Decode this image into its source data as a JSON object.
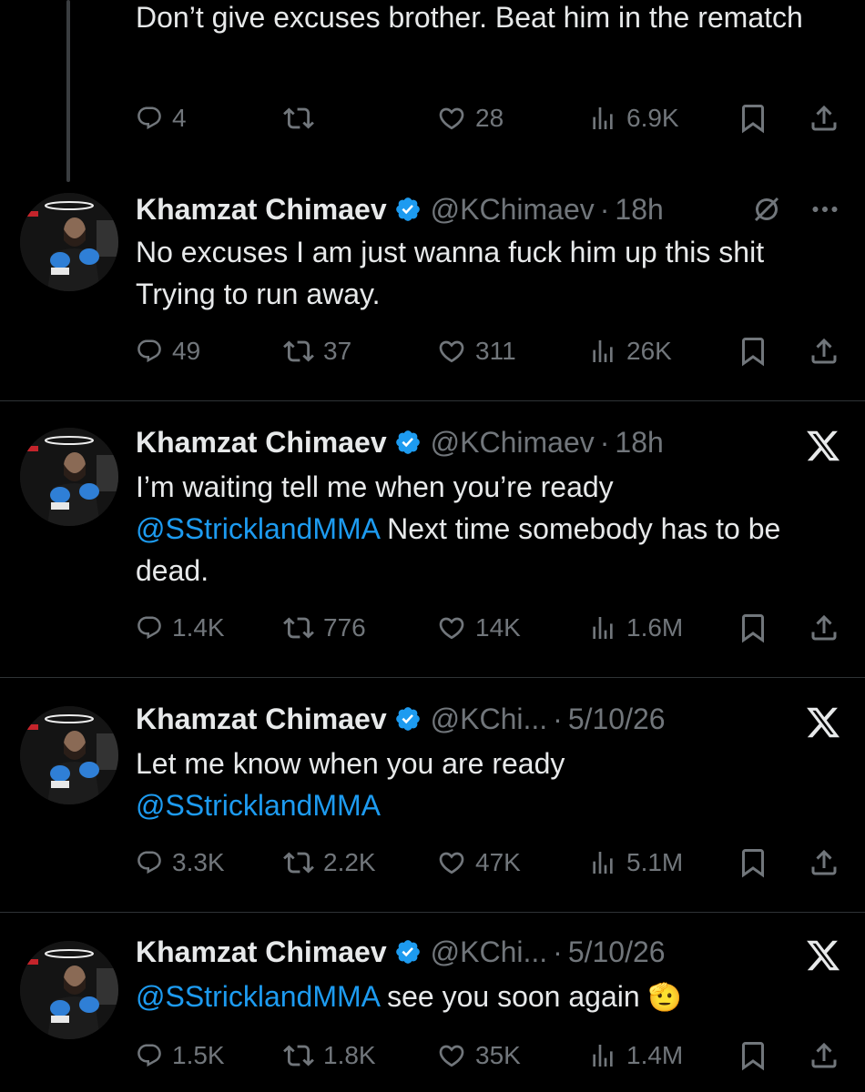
{
  "tweets": [
    {
      "text": "Don’t give excuses brother. Beat him in the rematch",
      "replies": "4",
      "reposts": "",
      "likes": "28",
      "views": "6.9K"
    },
    {
      "name": "Khamzat Chimaev",
      "handle": "@KChimaev",
      "time": "18h",
      "text": "No excuses I am just wanna fuck him up this shit Trying to run away.",
      "replies": "49",
      "reposts": "37",
      "likes": "311",
      "views": "26K",
      "corner_icon": "grok-icon"
    },
    {
      "name": "Khamzat Chimaev",
      "handle": "@KChimaev",
      "time": "18h",
      "text_before": "I’m waiting tell me when you’re ready",
      "mention": "@SStricklandMMA",
      "text_after": " Next time somebody has to be dead.",
      "replies": "1.4K",
      "reposts": "776",
      "likes": "14K",
      "views": "1.6M",
      "corner_icon": "x-logo-icon"
    },
    {
      "name": "Khamzat Chimaev",
      "handle": "@KChi...",
      "time": "5/10/26",
      "text_before": "Let me know when you are ready",
      "mention": "@SStricklandMMA",
      "replies": "3.3K",
      "reposts": "2.2K",
      "likes": "47K",
      "views": "5.1M",
      "corner_icon": "x-logo-icon"
    },
    {
      "name": "Khamzat Chimaev",
      "handle": "@KChi...",
      "time": "5/10/26",
      "mention": "@SStricklandMMA",
      "text_after": " see you soon again",
      "emoji": "🫡",
      "replies": "1.5K",
      "reposts": "1.8K",
      "likes": "35K",
      "views": "1.4M",
      "corner_icon": "x-logo-icon"
    }
  ],
  "sep": "·",
  "colors": {
    "background": "#000000",
    "text": "#e7e9ea",
    "muted": "#71767b",
    "link": "#1d9bf0",
    "verified": "#1d9bf0"
  }
}
